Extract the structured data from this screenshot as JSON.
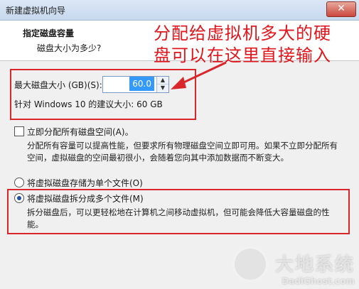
{
  "window": {
    "title": "新建虚拟机向导",
    "close_glyph": "✕"
  },
  "header": {
    "title": "指定磁盘容量",
    "subtitle": "磁盘大小为多少?"
  },
  "annotation": {
    "line1": "分配给虚拟机多大的硬",
    "line2": "盘可以在这里直接输入"
  },
  "disk": {
    "max_size_label": "最大磁盘大小 (GB)(S):",
    "max_size_value": "60.0",
    "recommend_text": "针对 Windows 10 的建议大小: 60 GB"
  },
  "allocate": {
    "label": "立即分配所有磁盘空间(A)。",
    "checked": false,
    "description_line1": "分配所有容量可以提高性能，但要求所有物理磁盘空间立即可用。如果不立即分配所有",
    "description_line2": "空间，虚拟磁盘的空间最初很小，会随着您向其中添加数据而不断变大。"
  },
  "storage": {
    "single_label": "将虚拟磁盘存储为单个文件(O)",
    "single_selected": false,
    "split_label": "将虚拟磁盘拆分成多个文件(M)",
    "split_selected": true,
    "split_desc_line1": "拆分磁盘后，可以更轻松地在计算机之间移动虚拟机，但可能会降低大容量磁盘的性",
    "split_desc_line2": "能。"
  },
  "watermark": {
    "brand": "大地系统",
    "url": "DadiGhost.com"
  },
  "colors": {
    "annotation_red": "#e0161c",
    "selection_blue": "#3399ff"
  }
}
